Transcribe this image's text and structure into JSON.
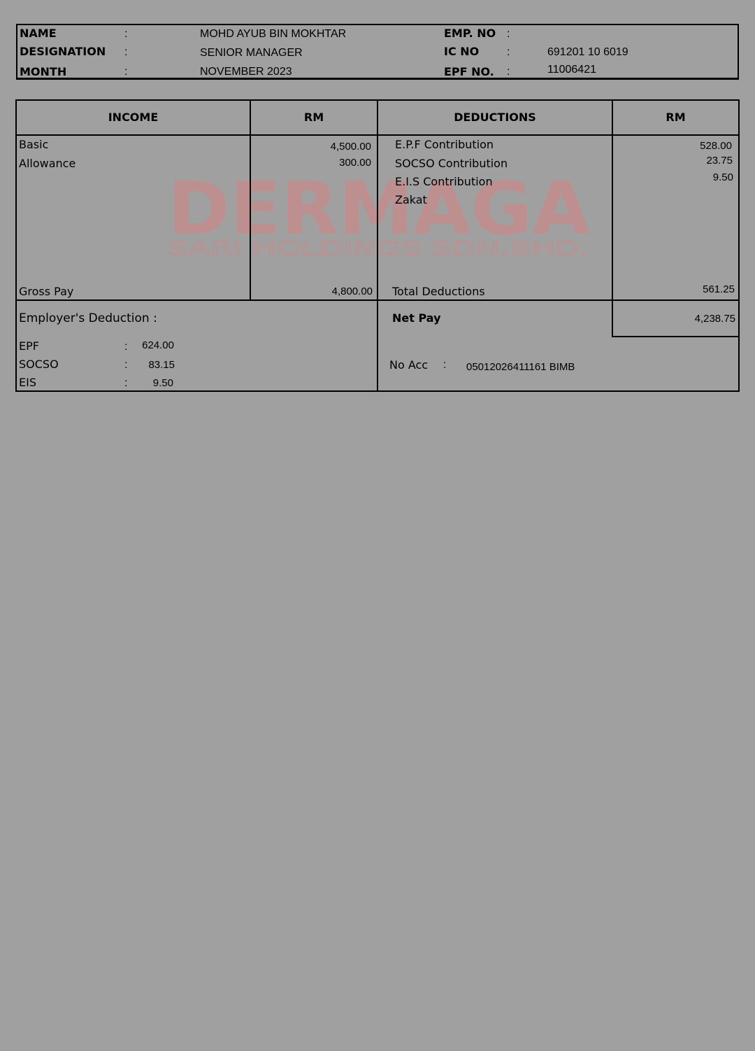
{
  "header": {
    "name_label": "NAME",
    "name_value": "MOHD AYUB BIN MOKHTAR",
    "designation_label": "DESIGNATION",
    "designation_value": "SENIOR MANAGER",
    "month_label": "MONTH",
    "month_value": "NOVEMBER 2023",
    "emp_no_label": "EMP. NO",
    "emp_no_value": "",
    "ic_no_label": "IC NO",
    "ic_no_value": "691201 10 6019",
    "epf_no_label": "EPF NO.",
    "epf_no_value": "11006421",
    "colon": ":"
  },
  "table": {
    "income_header": "INCOME",
    "rm_header": "RM",
    "deductions_header": "DEDUCTIONS",
    "income_items": [
      {
        "label": "Basic",
        "amount": "4,500.00"
      },
      {
        "label": "Allowance",
        "amount": "300.00"
      }
    ],
    "deduction_items": [
      {
        "label": "E.P.F Contribution",
        "amount": "528.00"
      },
      {
        "label": "SOCSO Contribution",
        "amount": "23.75"
      },
      {
        "label": "E.I.S Contribution",
        "amount": "9.50"
      },
      {
        "label": "Zakat",
        "amount": ""
      }
    ],
    "gross_pay_label": "Gross Pay",
    "gross_pay_amount": "4,800.00",
    "total_deductions_label": "Total Deductions",
    "total_deductions_amount": "561.25"
  },
  "employer": {
    "title": "Employer's Deduction :",
    "items": [
      {
        "label": "EPF",
        "amount": "624.00"
      },
      {
        "label": "SOCSO",
        "amount": "83.15"
      },
      {
        "label": "EIS",
        "amount": "9.50"
      }
    ]
  },
  "net": {
    "label": "Net Pay",
    "amount": "4,238.75",
    "acc_label": "No Acc",
    "acc_value": "05012026411161 BIMB"
  },
  "watermark": {
    "title": "DERMAGA",
    "subtitle": "SARI HOLDINGS SDN.BHD.",
    "color": "#c98a8a"
  }
}
